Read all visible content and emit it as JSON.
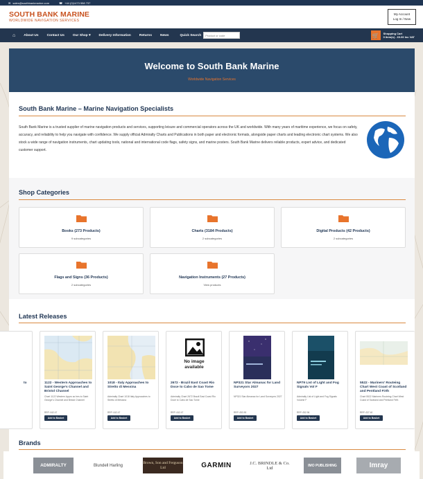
{
  "topbar": {
    "email": "sales@southbankmarine.com",
    "phone": "+44 (0)1473 558 737"
  },
  "logo": {
    "main": "SOUTH BANK MARINE",
    "sub": "WORLDWIDE NAVIGATION SERVICES"
  },
  "account": {
    "line1": "My Account",
    "line2": "Log In / New"
  },
  "nav": {
    "links": [
      "About Us",
      "Contact Us",
      "Our Shop ▾",
      "Delivery Information",
      "Returns",
      "News"
    ],
    "search_label": "Quick Search",
    "search_placeholder": "Product or code",
    "cart_title": "Shopping Cart",
    "cart_summary": "0 item(s) - £0.00 Inc VAT"
  },
  "hero": {
    "title": "Welcome to South Bank Marine",
    "tagline": "Worldwide Navigation Services"
  },
  "about": {
    "title": "South Bank Marine – Marine Navigation Specialists",
    "text": "South Bank Marine is a trusted supplier of marine navigation products and services, supporting leisure and commercial operators across the UK and worldwide. With many years of maritime experience, we focus on safety, accuracy, and reliability to help you navigate with confidence. We supply official Admiralty Charts and Publications in both paper and electronic formats, alongside paper charts and leading electronic chart systems. We also stock a wide range of navigation instruments, chart updating tools, national and international code flags, safety signs, and marine posters. South Bank Marine delivers reliable products, expert advice, and dedicated customer support."
  },
  "categories": {
    "title": "Shop Categories",
    "items": [
      {
        "name": "Books (273 Products)",
        "sub": "9 subcategories"
      },
      {
        "name": "Charts (3184 Products)",
        "sub": "2 subcategories"
      },
      {
        "name": "Digital Products (42 Products)",
        "sub": "2 subcategories"
      },
      {
        "name": "Flags and Signs (36 Products)",
        "sub": "2 subcategories"
      },
      {
        "name": "Navigation Instruments (27 Products)",
        "sub": "View products"
      }
    ]
  },
  "releases": {
    "title": "Latest Releases",
    "basket_label": "Add to Basket",
    "no_image": "No image available",
    "products": [
      {
        "name": "to",
        "desc": "",
        "price": ""
      },
      {
        "name": "1122 - Western Approaches to Saint George's Channel and Bristol Channel",
        "desc": "Chart 1122 Western Appro ac hes to Saint George's Channel and Bristol Channel",
        "price": "RRP: £42.47"
      },
      {
        "name": "1018 - Italy Approaches to Stretto di Messina",
        "desc": "Admiralty Chart 1018 Italy Approaches to Stretto di Messina",
        "price": "RRP: £42.47"
      },
      {
        "name": "2672 - Brazil East Coast Rio Doce to Cabo de Sao Tome",
        "desc": "Admiralty Chart 2672 Brazil East Coast Rio Doce to Cabo de Sao Tome",
        "price": "RRP: £42.47"
      },
      {
        "name": "NP321 Star Almanac for Land Surveyors 2027",
        "desc": "NP321 Star Almanac for Land Surveyors 2027",
        "price": "RRP: £53.90"
      },
      {
        "name": "NP79 List of Light and Fog Signals Vol F",
        "desc": "Admiralty List of Light and Fog Signals Volume F",
        "price": "RRP: £52.96"
      },
      {
        "name": "5522 - Mariners' Routeing Chart West Coast of Scotland and Pentland Firth",
        "desc": "Chart 5522 Mariners Routeing Chart West Coast of Scotland and Pentland Firth",
        "price": "RRP: £37.40"
      }
    ]
  },
  "brands": {
    "title": "Brands",
    "items": [
      "ADMIRALTY",
      "Blundell Harling",
      "Brown, Son and Ferguson Ltd",
      "GARMIN",
      "J.C. BRINDLE & Co. Ltd",
      "IMO PUBLISHING",
      "Imray"
    ]
  },
  "colors": {
    "navy": "#23364f",
    "accent": "#e8742c",
    "hero": "#2b4a6b"
  }
}
